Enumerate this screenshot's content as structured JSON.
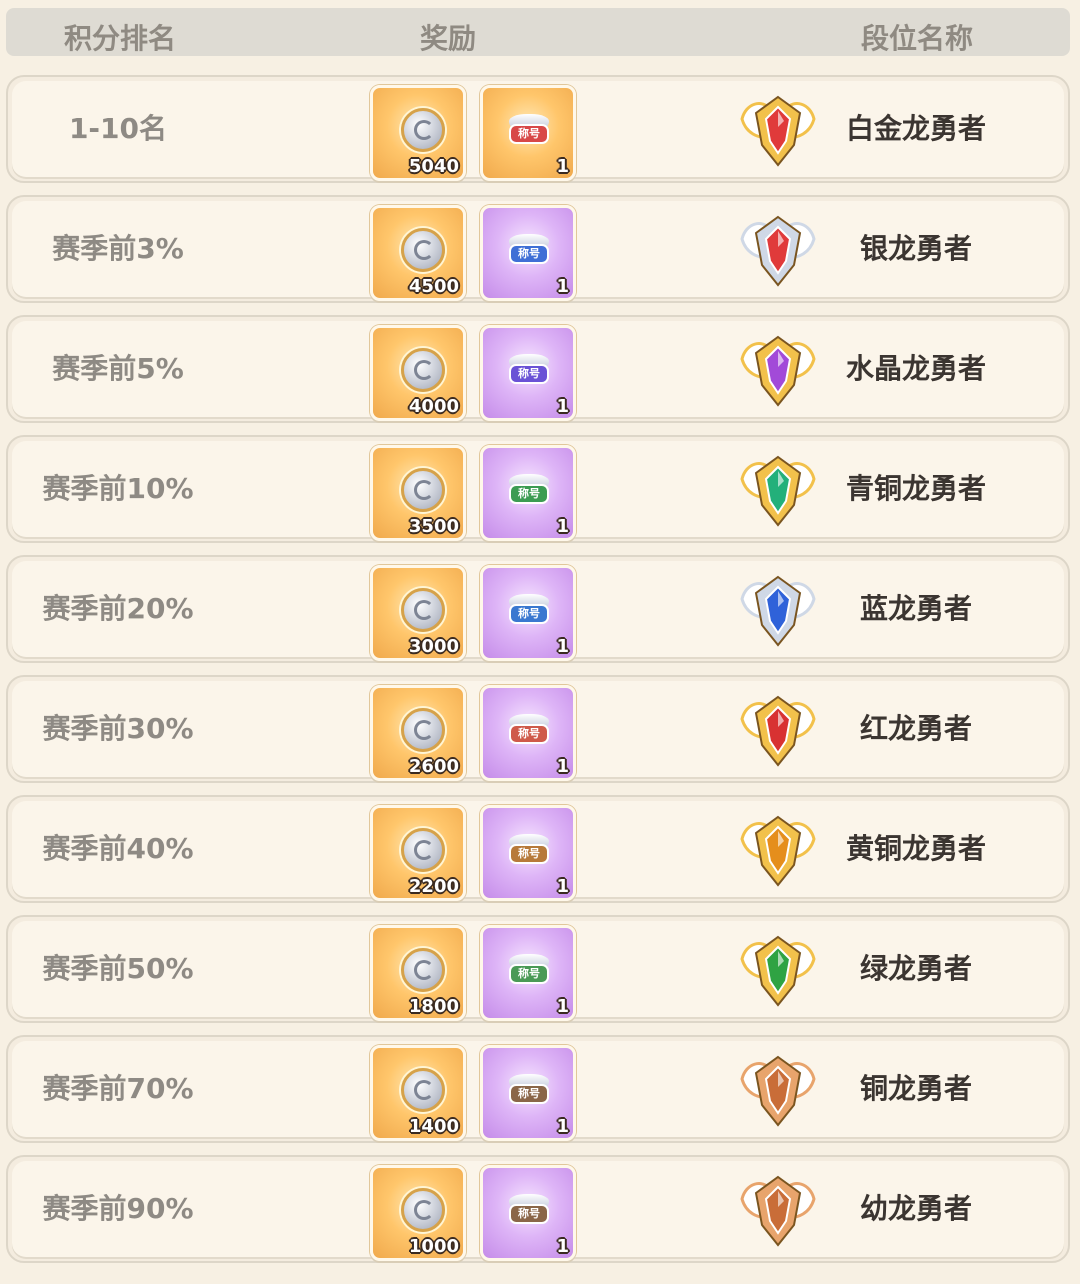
{
  "header": {
    "rank_label": "积分排名",
    "reward_label": "奖励",
    "tier_label": "段位名称"
  },
  "title_item_text": "称号",
  "rows": [
    {
      "rank": "1-10名",
      "coin_qty": "5040",
      "title_qty": "1",
      "tier": "白金龙勇者",
      "badge_icon": "platinum-dragon-badge",
      "gem_color": "#e03a3a",
      "frame_color": "#f2c14b",
      "title_plate_color": "#d84848",
      "title_card_style": "gold"
    },
    {
      "rank": "赛季前3%",
      "coin_qty": "4500",
      "title_qty": "1",
      "tier": "银龙勇者",
      "badge_icon": "silver-dragon-badge",
      "gem_color": "#e03a3a",
      "frame_color": "#cfd8e6",
      "title_plate_color": "#3f6fd6",
      "title_card_style": "purple"
    },
    {
      "rank": "赛季前5%",
      "coin_qty": "4000",
      "title_qty": "1",
      "tier": "水晶龙勇者",
      "badge_icon": "crystal-dragon-badge",
      "gem_color": "#a24ad8",
      "frame_color": "#f2c14b",
      "title_plate_color": "#6a52d6",
      "title_card_style": "purple"
    },
    {
      "rank": "赛季前10%",
      "coin_qty": "3500",
      "title_qty": "1",
      "tier": "青铜龙勇者",
      "badge_icon": "bronze-cyan-dragon-badge",
      "gem_color": "#23b07a",
      "frame_color": "#f2c14b",
      "title_plate_color": "#3c9c52",
      "title_card_style": "purple"
    },
    {
      "rank": "赛季前20%",
      "coin_qty": "3000",
      "title_qty": "1",
      "tier": "蓝龙勇者",
      "badge_icon": "blue-dragon-badge",
      "gem_color": "#2f62d9",
      "frame_color": "#cfd8e6",
      "title_plate_color": "#3a78d0",
      "title_card_style": "purple"
    },
    {
      "rank": "赛季前30%",
      "coin_qty": "2600",
      "title_qty": "1",
      "tier": "红龙勇者",
      "badge_icon": "red-dragon-badge",
      "gem_color": "#d83232",
      "frame_color": "#f2c14b",
      "title_plate_color": "#cf5a4a",
      "title_card_style": "purple"
    },
    {
      "rank": "赛季前40%",
      "coin_qty": "2200",
      "title_qty": "1",
      "tier": "黄铜龙勇者",
      "badge_icon": "brass-dragon-badge",
      "gem_color": "#e58e1c",
      "frame_color": "#f2c14b",
      "title_plate_color": "#b77a3a",
      "title_card_style": "purple"
    },
    {
      "rank": "赛季前50%",
      "coin_qty": "1800",
      "title_qty": "1",
      "tier": "绿龙勇者",
      "badge_icon": "green-dragon-badge",
      "gem_color": "#2fa343",
      "frame_color": "#f2c14b",
      "title_plate_color": "#4a9a56",
      "title_card_style": "purple"
    },
    {
      "rank": "赛季前70%",
      "coin_qty": "1400",
      "title_qty": "1",
      "tier": "铜龙勇者",
      "badge_icon": "copper-dragon-badge",
      "gem_color": "#c96d38",
      "frame_color": "#e8a46c",
      "title_plate_color": "#8a6648",
      "title_card_style": "purple"
    },
    {
      "rank": "赛季前90%",
      "coin_qty": "1000",
      "title_qty": "1",
      "tier": "幼龙勇者",
      "badge_icon": "young-dragon-badge",
      "gem_color": "#c96d38",
      "frame_color": "#e8a46c",
      "title_plate_color": "#8a6648",
      "title_card_style": "purple"
    }
  ]
}
